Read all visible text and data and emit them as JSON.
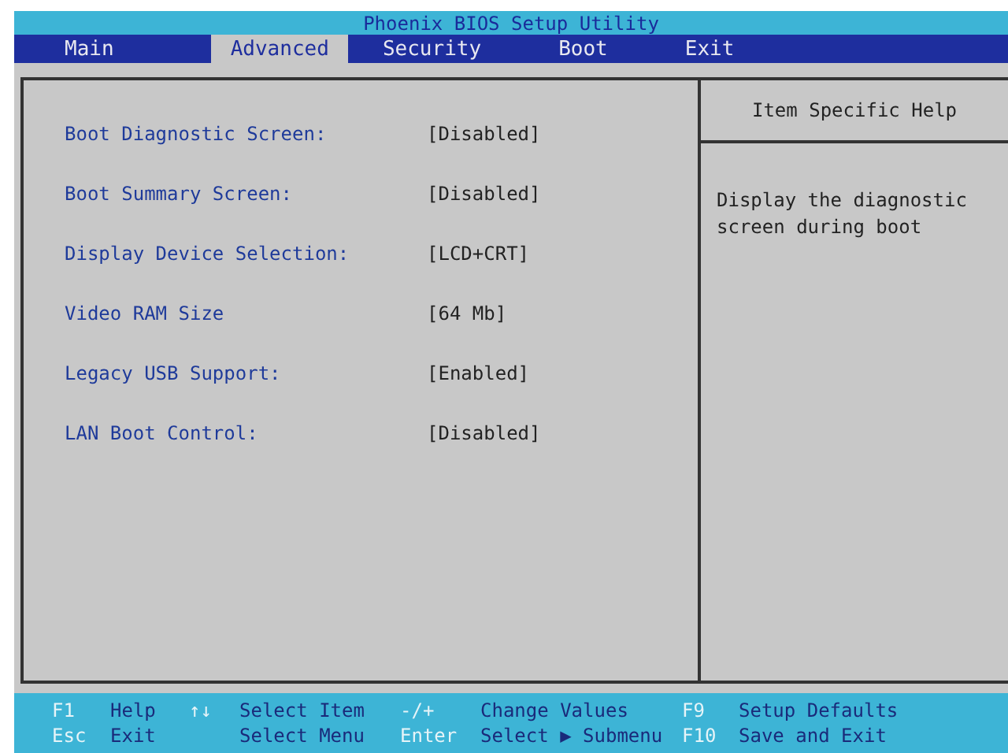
{
  "window": {
    "title": "Phoenix BIOS Setup Utility"
  },
  "tabs": [
    {
      "label": "Main",
      "selected": false
    },
    {
      "label": "Advanced",
      "selected": true
    },
    {
      "label": "Security",
      "selected": false
    },
    {
      "label": "Boot",
      "selected": false
    },
    {
      "label": "Exit",
      "selected": false
    }
  ],
  "settings": [
    {
      "label": "Boot Diagnostic Screen:",
      "value": "[Disabled]"
    },
    {
      "label": "Boot Summary Screen:",
      "value": "[Disabled]"
    },
    {
      "label": "Display Device Selection:",
      "value": "[LCD+CRT]"
    },
    {
      "label": "Video RAM Size",
      "value": "[64 Mb]"
    },
    {
      "label": "Legacy USB Support:",
      "value": "[Enabled]"
    },
    {
      "label": "LAN Boot Control:",
      "value": "[Disabled]"
    }
  ],
  "help": {
    "title": "Item Specific Help",
    "text": "Display the diagnostic screen during boot"
  },
  "status_bar": [
    [
      {
        "key": "F1",
        "action": "Help"
      },
      {
        "key": "↑↓",
        "action": "Select Item"
      },
      {
        "key": "-/+",
        "action": "Change Values"
      },
      {
        "key": "F9",
        "action": "Setup Defaults"
      }
    ],
    [
      {
        "key": "Esc",
        "action": "Exit"
      },
      {
        "action": "Select Menu"
      },
      {
        "key": "Enter",
        "action": "Select ▶ Submenu"
      },
      {
        "key": "F10",
        "action": "Save and Exit"
      }
    ]
  ]
}
